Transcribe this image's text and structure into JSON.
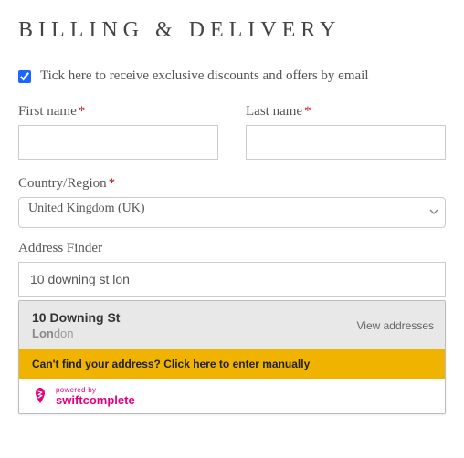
{
  "heading": "BILLING & DELIVERY",
  "marketing": {
    "label": "Tick here to receive exclusive discounts and offers by email",
    "checked": true
  },
  "fields": {
    "first_name": {
      "label": "First name",
      "required": true,
      "value": ""
    },
    "last_name": {
      "label": "Last name",
      "required": true,
      "value": ""
    },
    "country": {
      "label": "Country/Region",
      "required": true,
      "selected": "United Kingdom (UK)"
    },
    "address_finder": {
      "label": "Address Finder",
      "value": "10 downing st lon"
    }
  },
  "dropdown": {
    "suggestion": {
      "line1": "10 Downing St",
      "line2_match": "Lon",
      "line2_rest": "don",
      "action": "View addresses"
    },
    "manual": "Can't find your address? Click here to enter manually",
    "brand": {
      "top": "powered by",
      "bottom": "swiftcomplete"
    }
  },
  "colors": {
    "required": "#c00",
    "accent": "#1a66ff",
    "manual_bg": "#f0b400",
    "brand": "#e6007e"
  }
}
